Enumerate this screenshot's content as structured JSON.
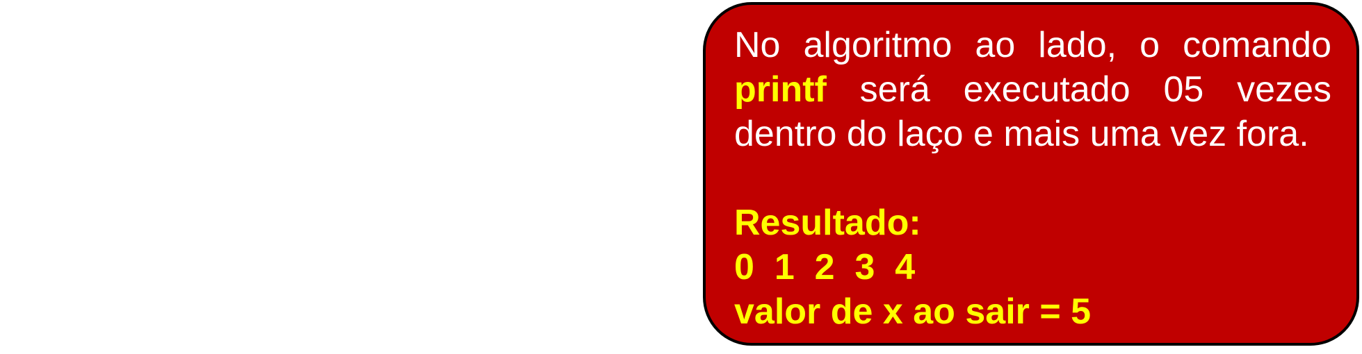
{
  "callout": {
    "background_color": "#c00000",
    "highlight_color": "#ffff00",
    "text_before_keyword": "No algoritmo ao lado, o comando ",
    "keyword": "printf",
    "text_after_keyword": " será executado 05 vezes dentro do laço e mais uma vez fora.",
    "result_label": "Resultado:",
    "result_values": "0  1  2  3  4",
    "exit_value_line": "valor de x ao sair = 5"
  }
}
